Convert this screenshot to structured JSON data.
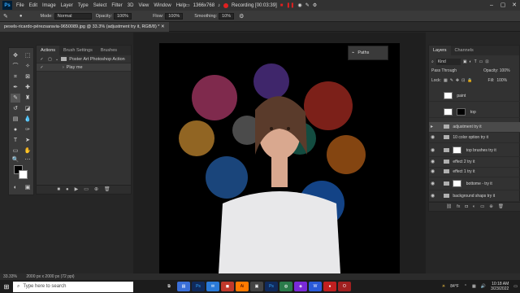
{
  "menubar": {
    "app_logo": "Ps",
    "items": [
      "File",
      "Edit",
      "Image",
      "Layer",
      "Type",
      "Select",
      "Filter",
      "3D",
      "View",
      "Window",
      "Help"
    ],
    "resolution": "1366x768",
    "recording_label": "Recording [00:03:39]"
  },
  "options_bar": {
    "mode_label": "Mode:",
    "mode_value": "Normal",
    "opacity_label": "Opacity:",
    "opacity_value": "100%",
    "flow_label": "Flow:",
    "flow_value": "100%",
    "smoothing_label": "Smoothing:",
    "smoothing_value": "10%"
  },
  "document": {
    "tab_title": "pexels-ricardo-pérezsaravia-9650089.jpg @ 33.3% (adjustment try it, RGB/8) *"
  },
  "actions_panel": {
    "tabs": [
      "Actions",
      "Brush Settings",
      "Brushes"
    ],
    "rows": [
      {
        "label": "Poster Art Photoshop Action",
        "icon": "folder-icon"
      },
      {
        "label": "Play me",
        "icon": "action-icon"
      }
    ]
  },
  "paths_panel": {
    "label": "Paths"
  },
  "layers_panel": {
    "tabs": [
      "Layers",
      "Channels"
    ],
    "kind_label": "Kind",
    "blend_mode": "Pass Through",
    "opacity_label": "Opacity:",
    "opacity_value": "100%",
    "lock_label": "Lock:",
    "fill_label": "Fill:",
    "fill_value": "100%",
    "layers": [
      {
        "name": "paint",
        "type": "image"
      },
      {
        "name": "top",
        "type": "image"
      },
      {
        "name": "adjustment try it",
        "type": "group"
      },
      {
        "name": "10 color option try it",
        "type": "group"
      },
      {
        "name": "top brushes try it",
        "type": "group"
      },
      {
        "name": "effect 2 try it",
        "type": "group"
      },
      {
        "name": "effect 1 try it",
        "type": "group"
      },
      {
        "name": "bottome - try it",
        "type": "group"
      },
      {
        "name": "background shaps try it",
        "type": "group"
      }
    ]
  },
  "status_bar": {
    "zoom": "33.33%",
    "doc_size": "2000 px x 2000 px (72 ppi)"
  },
  "taskbar": {
    "search_placeholder": "Type here to search",
    "weather": "84°F",
    "time": "10:18 AM",
    "date": "3/23/2022"
  },
  "colors": {
    "accent": "#31a8ff",
    "record": "#e02020",
    "panel_bg": "#323232"
  }
}
